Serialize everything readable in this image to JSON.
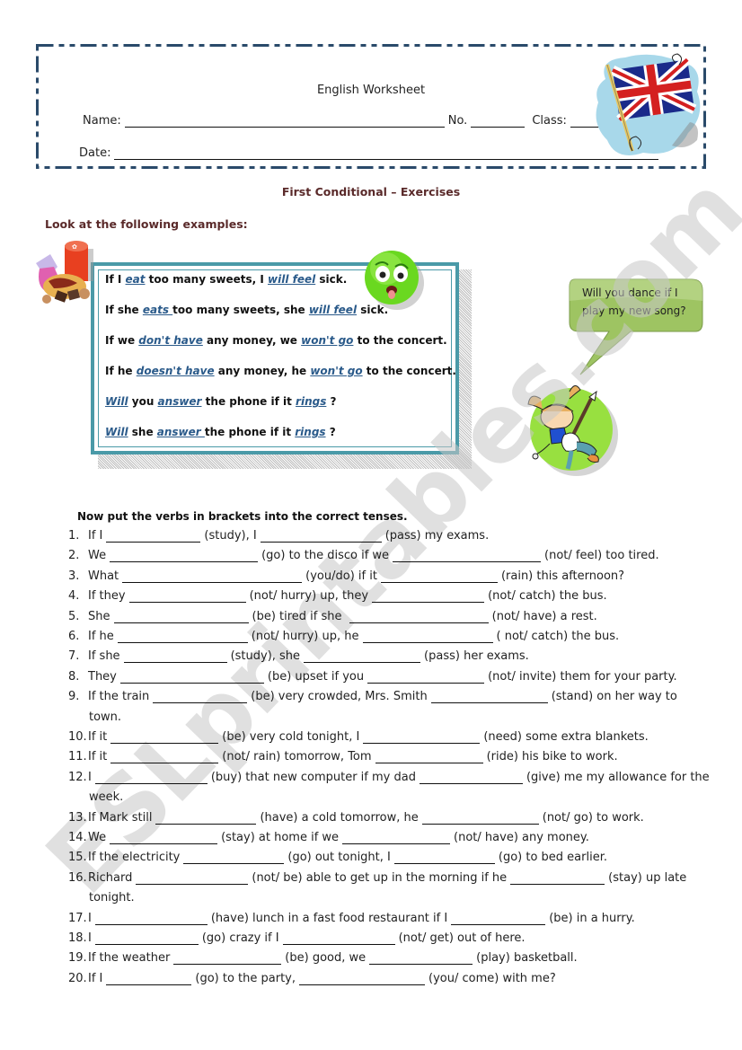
{
  "header": {
    "title": "English Worksheet",
    "name_label": "Name:",
    "no_label": "No.",
    "class_label": "Class:",
    "date_label": "Date:",
    "border_color": "#2a4a6a",
    "flag_icon": "union-jack-flag-icon"
  },
  "document_title": "First Conditional – Exercises",
  "examples_heading": "Look at the following examples:",
  "examples": [
    [
      {
        "t": "If I "
      },
      {
        "v": "eat"
      },
      {
        "t": " too many sweets, I "
      },
      {
        "v": "will feel"
      },
      {
        "t": " sick."
      }
    ],
    [
      {
        "t": "If she "
      },
      {
        "v": "eats "
      },
      {
        "t": "too many sweets, she "
      },
      {
        "v": "will feel"
      },
      {
        "t": " sick."
      }
    ],
    [
      {
        "t": "If we "
      },
      {
        "v": "don't have"
      },
      {
        "t": " any money, we "
      },
      {
        "v": "won't go"
      },
      {
        "t": " to the concert."
      }
    ],
    [
      {
        "t": "If he "
      },
      {
        "v": "doesn't have"
      },
      {
        "t": " any money, he "
      },
      {
        "v": "won't go"
      },
      {
        "t": " to the concert."
      }
    ],
    [
      {
        "v": "Will"
      },
      {
        "t": " you "
      },
      {
        "v": "answer"
      },
      {
        "t": " the phone if it "
      },
      {
        "v": "rings"
      },
      {
        "t": " ?"
      }
    ],
    [
      {
        "v": "Will"
      },
      {
        "t": " she "
      },
      {
        "v": "answer "
      },
      {
        "t": "the phone if it "
      },
      {
        "v": "rings"
      },
      {
        "t": " ?"
      }
    ]
  ],
  "speech_bubble": {
    "line1": "Will you dance if I",
    "line2": "play my new song?"
  },
  "exercise_instruction": "Now put the verbs in brackets into the correct tenses.",
  "exercises": [
    {
      "num": "1.",
      "parts": [
        "If I ",
        "_",
        " (study), I ",
        "_",
        " (pass) my exams."
      ],
      "blanks": [
        105,
        135
      ]
    },
    {
      "num": "2.",
      "parts": [
        "We ",
        "_",
        " (go) to the disco if we ",
        "_",
        " (not/ feel) too tired."
      ],
      "blanks": [
        165,
        165
      ]
    },
    {
      "num": "3.",
      "parts": [
        "What ",
        "_",
        "(you/do) if it ",
        "_",
        " (rain) this afternoon?"
      ],
      "blanks": [
        200,
        130
      ]
    },
    {
      "num": "4.",
      "parts": [
        "If they ",
        "_",
        " (not/ hurry) up, they ",
        "_",
        " (not/ catch) the bus."
      ],
      "blanks": [
        130,
        125
      ]
    },
    {
      "num": "5.",
      "parts": [
        "She ",
        "_",
        " (be) tired if she  ",
        "_",
        " (not/ have) a rest."
      ],
      "blanks": [
        150,
        155
      ]
    },
    {
      "num": "6.",
      "parts": [
        "If he ",
        "_",
        " (not/ hurry) up, he ",
        "_",
        " ( not/ catch) the bus."
      ],
      "blanks": [
        145,
        145
      ]
    },
    {
      "num": "7.",
      "parts": [
        "If she ",
        "_",
        " (study), she ",
        "_",
        " (pass) her exams."
      ],
      "blanks": [
        115,
        130
      ]
    },
    {
      "num": "8.",
      "parts": [
        "They ",
        "_",
        " (be) upset if you ",
        "_",
        " (not/ invite) them for your party."
      ],
      "blanks": [
        160,
        130
      ]
    },
    {
      "num": "9.",
      "parts": [
        "If the train ",
        "_",
        " (be) very crowded, Mrs. Smith ",
        "_",
        " (stand) on her way to"
      ],
      "blanks": [
        105,
        130
      ],
      "cont": "town."
    },
    {
      "num": "10.",
      "parts": [
        "If it ",
        "_",
        " (be) very cold tonight, I ",
        "_",
        "(need) some extra blankets."
      ],
      "blanks": [
        120,
        130
      ]
    },
    {
      "num": "11.",
      "parts": [
        "If it ",
        "_",
        " (not/ rain) tomorrow, Tom ",
        "_",
        " (ride) his bike to work."
      ],
      "blanks": [
        120,
        120
      ]
    },
    {
      "num": "12.",
      "parts": [
        "I ",
        "_",
        " (buy) that new computer if my dad ",
        "_",
        "(give) me my allowance for the"
      ],
      "blanks": [
        125,
        115
      ],
      "cont": "week."
    },
    {
      "num": "13.",
      "parts": [
        "If Mark still ",
        "_",
        " (have) a cold tomorrow, he ",
        "_",
        " (not/ go) to work."
      ],
      "blanks": [
        112,
        130
      ]
    },
    {
      "num": "14.",
      "parts": [
        "We ",
        "_",
        " (stay) at home if we ",
        "_",
        " (not/ have) any money."
      ],
      "blanks": [
        120,
        120
      ]
    },
    {
      "num": "15.",
      "parts": [
        "If the electricity ",
        "_",
        " (go) out tonight, I ",
        "_",
        " (go) to bed earlier."
      ],
      "blanks": [
        112,
        112
      ]
    },
    {
      "num": "16.",
      "parts": [
        "Richard ",
        "_",
        " (not/ be) able to get up in the morning if he ",
        "_",
        " (stay) up late"
      ],
      "blanks": [
        125,
        105
      ],
      "cont": "tonight."
    },
    {
      "num": "17.",
      "parts": [
        "I ",
        "_",
        " (have) lunch in a fast food restaurant if I ",
        "_",
        " (be) in a hurry."
      ],
      "blanks": [
        125,
        105
      ]
    },
    {
      "num": "18.",
      "parts": [
        "I ",
        "_",
        " (go) crazy if I ",
        "_",
        " (not/ get) out of here."
      ],
      "blanks": [
        115,
        125
      ]
    },
    {
      "num": "19.",
      "parts": [
        "If the weather ",
        "_",
        " (be) good, we ",
        "_",
        " (play) basketball."
      ],
      "blanks": [
        120,
        115
      ]
    },
    {
      "num": "20.",
      "parts": [
        "If I ",
        "_",
        " (go) to the party, ",
        "_",
        " (you/ come) with me?"
      ],
      "blanks": [
        95,
        140
      ]
    }
  ],
  "watermark": "ESLprintables.com",
  "colors": {
    "title": "#5a2a2a",
    "example_verb": "#2a5a8a",
    "example_border": "#4a9aa8",
    "watermark": "#c8c8c8"
  }
}
